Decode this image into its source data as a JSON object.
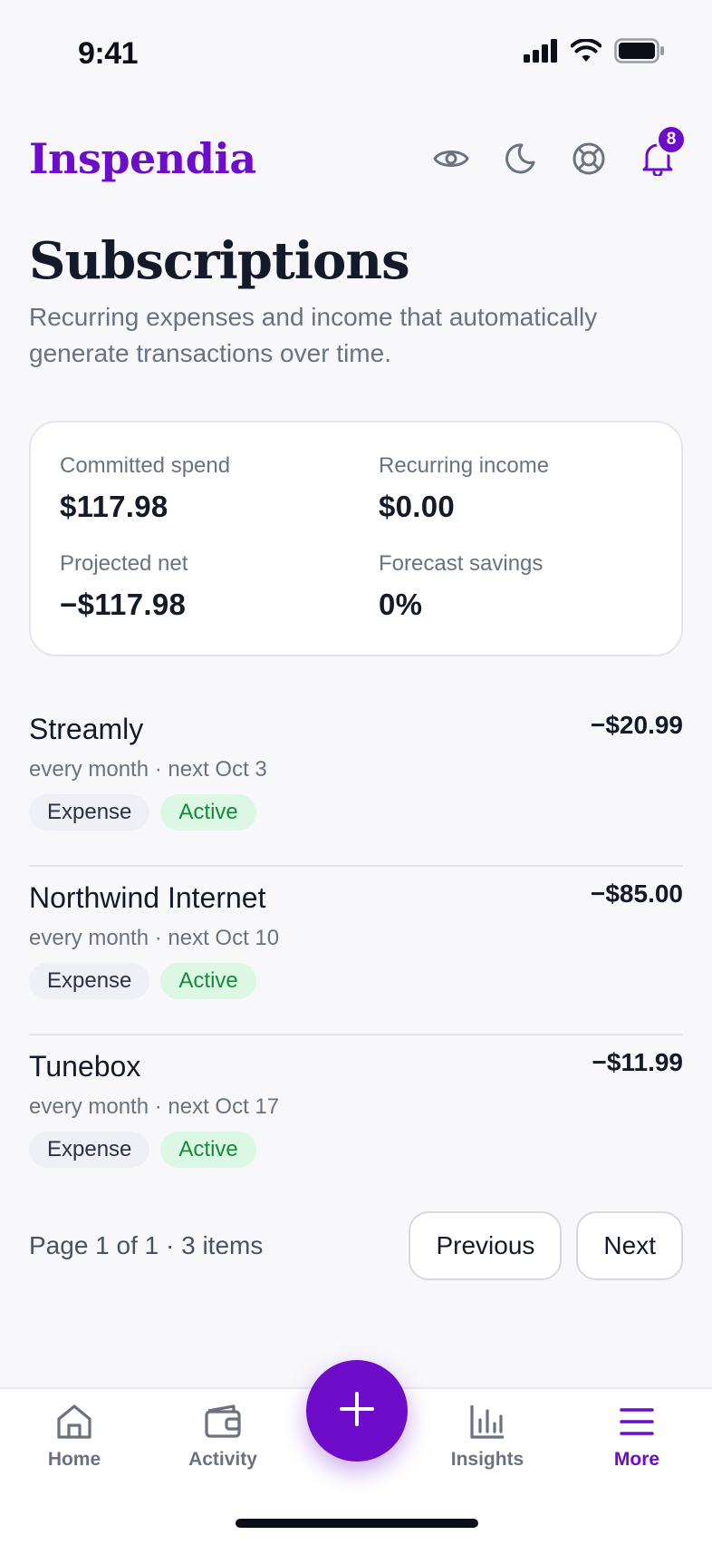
{
  "status_bar": {
    "time": "9:41",
    "icons": [
      "signal-icon",
      "wifi-icon",
      "battery-icon"
    ]
  },
  "header": {
    "brand": "Inspendia",
    "icons": [
      "eye-icon",
      "moon-icon",
      "help-icon",
      "bell-icon"
    ],
    "notifications_count": "8"
  },
  "page": {
    "title": "Subscriptions",
    "subtitle": "Recurring expenses and income that automatically generate transactions over time."
  },
  "summary": {
    "committed_spend": {
      "label": "Committed spend",
      "value": "$117.98"
    },
    "recurring_income": {
      "label": "Recurring income",
      "value": "$0.00"
    },
    "projected_net": {
      "label": "Projected net",
      "value": "−$117.98"
    },
    "forecast_savings": {
      "label": "Forecast savings",
      "value": "0%"
    }
  },
  "subscriptions": [
    {
      "name": "Streamly",
      "amount": "−$20.99",
      "schedule": "every month · next Oct 3",
      "type": "Expense",
      "status": "Active"
    },
    {
      "name": "Northwind Internet",
      "amount": "−$85.00",
      "schedule": "every month · next Oct 10",
      "type": "Expense",
      "status": "Active"
    },
    {
      "name": "Tunebox",
      "amount": "−$11.99",
      "schedule": "every month · next Oct 17",
      "type": "Expense",
      "status": "Active"
    }
  ],
  "pagination": {
    "info": "Page 1 of 1 · 3 items",
    "previous": "Previous",
    "next": "Next"
  },
  "nav": {
    "home": "Home",
    "activity": "Activity",
    "insights": "Insights",
    "more": "More",
    "active": "more"
  },
  "colors": {
    "brand": "#6d0dc9",
    "active_tag_bg": "#dcf7e3",
    "active_tag_text": "#158a3a",
    "text": "#141a29",
    "muted": "#6a7280"
  }
}
